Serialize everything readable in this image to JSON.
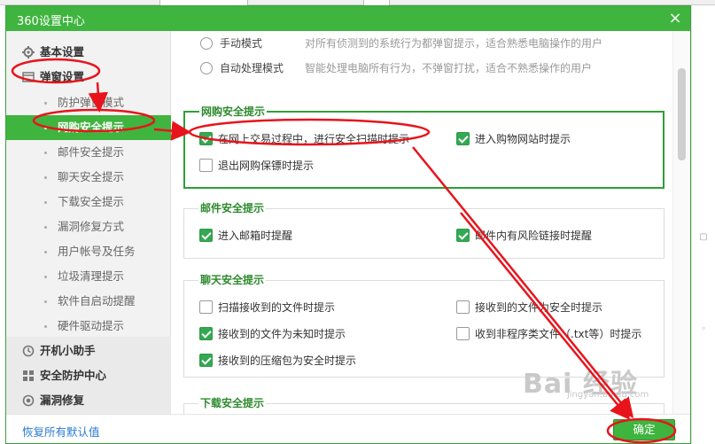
{
  "dialog": {
    "title": "360设置中心",
    "close_glyph": "×"
  },
  "sidebar": {
    "items": [
      {
        "label": "基本设置",
        "icon": "gear-icon"
      },
      {
        "label": "弹窗设置",
        "icon": "window-icon"
      },
      {
        "label": "防护弹窗模式"
      },
      {
        "label": "网购安全提示",
        "active": true
      },
      {
        "label": "邮件安全提示"
      },
      {
        "label": "聊天安全提示"
      },
      {
        "label": "下载安全提示"
      },
      {
        "label": "漏洞修复方式"
      },
      {
        "label": "用户帐号及任务"
      },
      {
        "label": "垃圾清理提示"
      },
      {
        "label": "软件自启动提醒"
      },
      {
        "label": "硬件驱动提示"
      },
      {
        "label": "开机小助手",
        "icon": "clock-icon"
      },
      {
        "label": "安全防护中心",
        "icon": "grid-icon"
      },
      {
        "label": "漏洞修复",
        "icon": "shield-icon"
      }
    ]
  },
  "content": {
    "mode_options": [
      {
        "label": "手动模式",
        "desc": "对所有侦测到的系统行为都弹窗提示，适合熟悉电脑操作的用户"
      },
      {
        "label": "自动处理模式",
        "desc": "智能处理电脑所有行为，不弹窗打扰，适合不熟悉操作的用户"
      }
    ],
    "sections": [
      {
        "title": "网购安全提示",
        "options": [
          {
            "label": "在网上交易过程中，进行安全扫描时提示",
            "checked": true
          },
          {
            "label": "进入购物网站时提示",
            "checked": true
          },
          {
            "label": "退出网购保镖时提示",
            "checked": false
          }
        ]
      },
      {
        "title": "邮件安全提示",
        "options": [
          {
            "label": "进入邮箱时提醒",
            "checked": true
          },
          {
            "label": "邮件内有风险链接时提醒",
            "checked": true
          }
        ]
      },
      {
        "title": "聊天安全提示",
        "options": [
          {
            "label": "扫描接收到的文件时提示",
            "checked": false
          },
          {
            "label": "接收到的文件为安全时提示",
            "checked": false
          },
          {
            "label": "接收到的文件为未知时提示",
            "checked": true
          },
          {
            "label": "收到非程序类文件（.txt等）时提示",
            "checked": false
          },
          {
            "label": "接收到的压缩包为安全时提示",
            "checked": true
          }
        ]
      },
      {
        "title": "下载安全提示",
        "options": []
      }
    ]
  },
  "footer": {
    "restore_label": "恢复所有默认值",
    "ok_label": "确定"
  },
  "watermark": {
    "text": "Bai 经验",
    "sub": "jingyan.baidu.com"
  },
  "colors": {
    "accent": "#3fb43f",
    "annotation": "#e8141b",
    "link": "#2a7bd2"
  }
}
